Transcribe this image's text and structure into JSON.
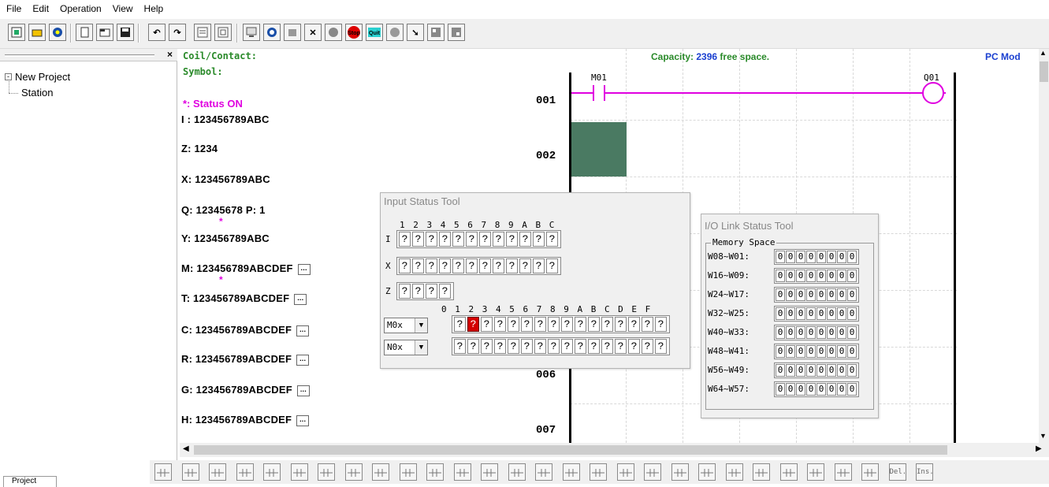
{
  "menu": [
    "File",
    "Edit",
    "Operation",
    "View",
    "Help"
  ],
  "toolbar_icons": [
    "project-icon",
    "open-folder-icon",
    "help-icon",
    "new-file-icon",
    "open-icon",
    "save-icon",
    "undo-icon",
    "redo-icon",
    "page-icon",
    "fit-icon",
    "monitor-icon",
    "refresh-icon",
    "stop-icon",
    "tool-icon",
    "earth-icon",
    "stop-run-icon",
    "quit-icon",
    "circle-icon",
    "arrow-icon",
    "grid-icon",
    "grid2-icon"
  ],
  "toolbar_labels": {
    "stop": "Stop",
    "quit": "Quit"
  },
  "tree": {
    "root": "New Project",
    "child": "Station",
    "close": "×"
  },
  "header": {
    "coil_contact": "Coil/Contact:",
    "symbol": "Symbol:",
    "capacity_label": "Capacity:",
    "capacity_value": "2396",
    "capacity_suffix": "free space.",
    "mode": "PC Mod"
  },
  "status": {
    "legend": "*: Status ON",
    "I": "I : 123456789ABC",
    "Z": "Z: 1234",
    "X": "X: 123456789ABC",
    "Q": "Q: 12345678   P: 1",
    "Y": "Y: 123456789ABC",
    "M": "M: 123456789ABCDEF",
    "T": "T: 123456789ABCDEF",
    "C": "C: 123456789ABCDEF",
    "R": "R: 123456789ABCDEF",
    "G": "G: 123456789ABCDEF",
    "H": "H: 123456789ABCDEF",
    "star": "*",
    "more": "..."
  },
  "rungs": [
    "001",
    "002",
    "006",
    "007"
  ],
  "contacts": {
    "m01": "M01",
    "q01": "Q01"
  },
  "input_tool": {
    "title": "Input Status Tool",
    "hex12": "1 2 3 4 5 6 7 8 9 A B C",
    "hex16": "0 1 2 3 4 5 6 7 8 9 A B C D E F",
    "row_I": "I",
    "row_X": "X",
    "row_Z": "Z",
    "m_select": "M0x",
    "n_select": "N0x",
    "cell_glyph": "?",
    "on_index": 1
  },
  "io_tool": {
    "title": "I/O Link Status Tool",
    "group": "Memory Space",
    "rows": [
      "W08~W01:",
      "W16~W09:",
      "W24~W17:",
      "W32~W25:",
      "W40~W33:",
      "W48~W41:",
      "W56~W49:",
      "W64~W57:"
    ],
    "zero": "0"
  },
  "bottom_icons": [
    "i-contact",
    "x-contact",
    "z-contact",
    "q-coil",
    "y-coil",
    "m-coil",
    "n-coil",
    "t-coil",
    "c-coil",
    "r-coil",
    "g-coil",
    "f-coil",
    "d-func",
    "h-func",
    "p-func",
    "l-func",
    "as-func",
    "md-func",
    "pi-func",
    "mx-func",
    "ar-func",
    "s-func",
    "dr-func",
    "mu-func",
    "lg-func",
    "line-func",
    "vline-func",
    "del-func",
    "ins-func"
  ],
  "bottom_labels": {
    "del": "Del.",
    "ins": "Ins."
  },
  "tab": "Project"
}
